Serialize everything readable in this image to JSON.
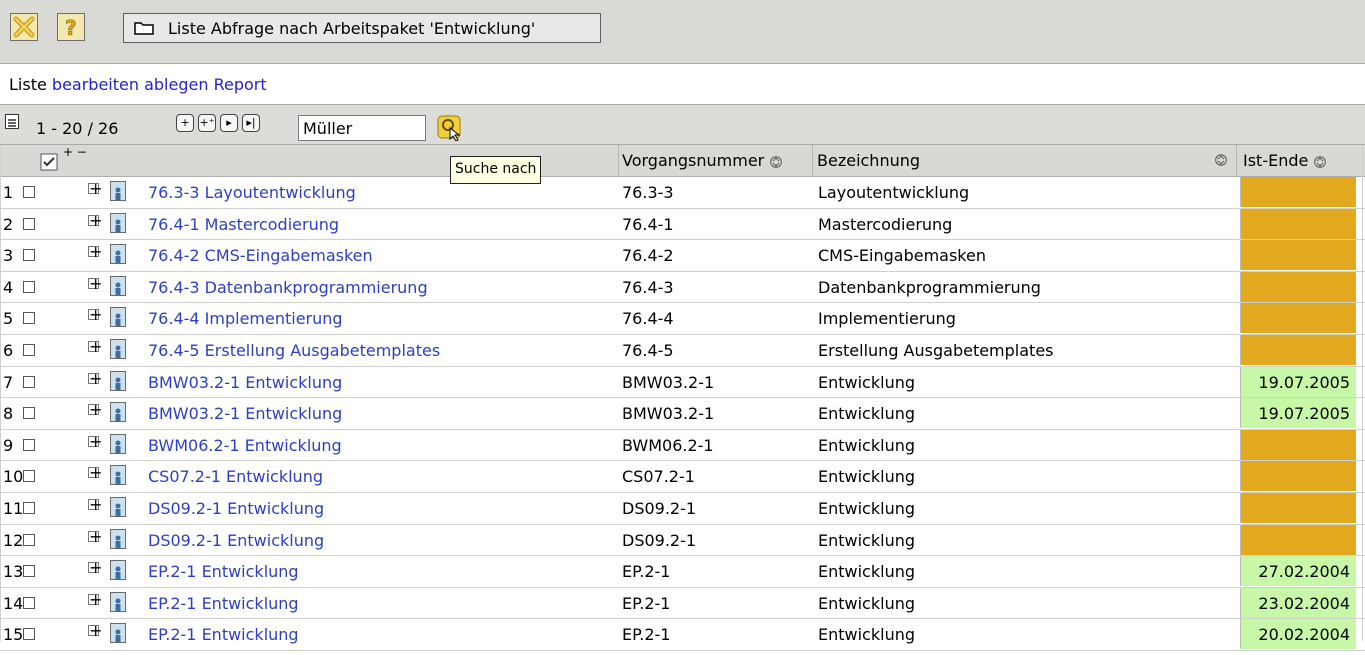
{
  "window": {
    "title": "Liste Abfrage nach Arbeitspaket 'Entwicklung'"
  },
  "titlebar": {
    "close_icon": "close-x-icon",
    "help_icon": "help-question-icon",
    "folder_icon": "folder-icon"
  },
  "links": {
    "prefix": "Liste",
    "edit": "bearbeiten",
    "archive": "ablegen",
    "report": "Report"
  },
  "toolbar": {
    "pager": "1 - 20 / 26",
    "search_value": "Müller",
    "tooltip": "Suche nach"
  },
  "columns": {
    "vorgang": "Vorgangsnummer",
    "bezeichnung": "Bezeichnung",
    "ist_ende": "Ist-Ende"
  },
  "colors": {
    "orange": "#e3a91e",
    "green": "#c6f8a8",
    "link": "#2d3fc0"
  },
  "rows": [
    {
      "num": "1",
      "name": "76.3-3 Layoutentwicklung",
      "vnr": "76.3-3",
      "bez": "Layoutentwicklung",
      "ende": "",
      "status": "orange"
    },
    {
      "num": "2",
      "name": "76.4-1 Mastercodierung",
      "vnr": "76.4-1",
      "bez": "Mastercodierung",
      "ende": "",
      "status": "orange"
    },
    {
      "num": "3",
      "name": "76.4-2 CMS-Eingabemasken",
      "vnr": "76.4-2",
      "bez": "CMS-Eingabemasken",
      "ende": "",
      "status": "orange"
    },
    {
      "num": "4",
      "name": "76.4-3 Datenbankprogrammierung",
      "vnr": "76.4-3",
      "bez": "Datenbankprogrammierung",
      "ende": "",
      "status": "orange"
    },
    {
      "num": "5",
      "name": "76.4-4 Implementierung",
      "vnr": "76.4-4",
      "bez": "Implementierung",
      "ende": "",
      "status": "orange"
    },
    {
      "num": "6",
      "name": "76.4-5 Erstellung Ausgabetemplates",
      "vnr": "76.4-5",
      "bez": "Erstellung Ausgabetemplates",
      "ende": "",
      "status": "orange"
    },
    {
      "num": "7",
      "name": "BMW03.2-1 Entwicklung",
      "vnr": "BMW03.2-1",
      "bez": "Entwicklung",
      "ende": "19.07.2005",
      "status": "green"
    },
    {
      "num": "8",
      "name": "BMW03.2-1 Entwicklung",
      "vnr": "BMW03.2-1",
      "bez": "Entwicklung",
      "ende": "19.07.2005",
      "status": "green"
    },
    {
      "num": "9",
      "name": "BWM06.2-1 Entwicklung",
      "vnr": "BWM06.2-1",
      "bez": "Entwicklung",
      "ende": "",
      "status": "orange"
    },
    {
      "num": "10",
      "name": "CS07.2-1 Entwicklung",
      "vnr": "CS07.2-1",
      "bez": "Entwicklung",
      "ende": "",
      "status": "orange"
    },
    {
      "num": "11",
      "name": "DS09.2-1 Entwicklung",
      "vnr": "DS09.2-1",
      "bez": "Entwicklung",
      "ende": "",
      "status": "orange"
    },
    {
      "num": "12",
      "name": "DS09.2-1 Entwicklung",
      "vnr": "DS09.2-1",
      "bez": "Entwicklung",
      "ende": "",
      "status": "orange"
    },
    {
      "num": "13",
      "name": "EP.2-1 Entwicklung",
      "vnr": "EP.2-1",
      "bez": "Entwicklung",
      "ende": "27.02.2004",
      "status": "green"
    },
    {
      "num": "14",
      "name": "EP.2-1 Entwicklung",
      "vnr": "EP.2-1",
      "bez": "Entwicklung",
      "ende": "23.02.2004",
      "status": "green"
    },
    {
      "num": "15",
      "name": "EP.2-1 Entwicklung",
      "vnr": "EP.2-1",
      "bez": "Entwicklung",
      "ende": "20.02.2004",
      "status": "green"
    }
  ]
}
